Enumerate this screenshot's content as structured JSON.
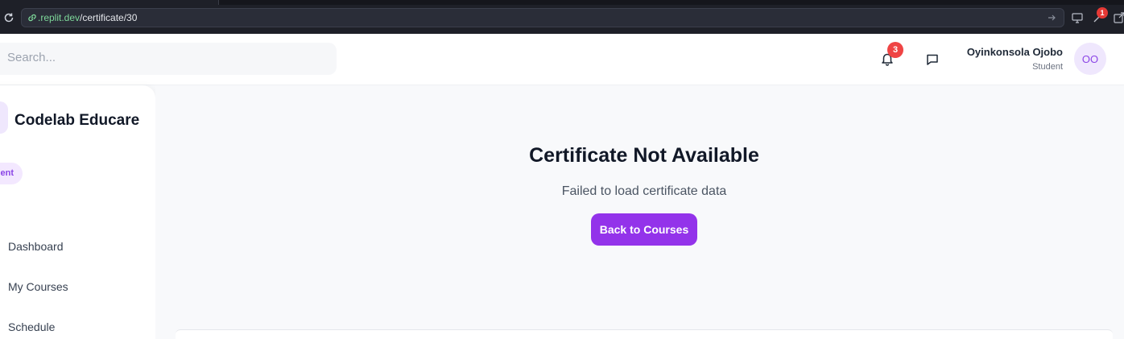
{
  "browser": {
    "url_domain": ".replit.dev",
    "url_path": "/certificate/30",
    "extension_badge": "1"
  },
  "header": {
    "search_placeholder": "Search...",
    "notification_count": "3",
    "user": {
      "name": "Oyinkonsola Ojobo",
      "role": "Student",
      "initials": "OO"
    }
  },
  "sidebar": {
    "brand": "Codelab Educare",
    "role_badge": "ent",
    "nav": [
      {
        "label": "Dashboard"
      },
      {
        "label": "My Courses"
      },
      {
        "label": "Schedule"
      }
    ]
  },
  "main": {
    "title": "Certificate Not Available",
    "message": "Failed to load certificate data",
    "button_label": "Back to Courses"
  },
  "colors": {
    "accent": "#9333ea",
    "badge_red": "#ef4444"
  }
}
